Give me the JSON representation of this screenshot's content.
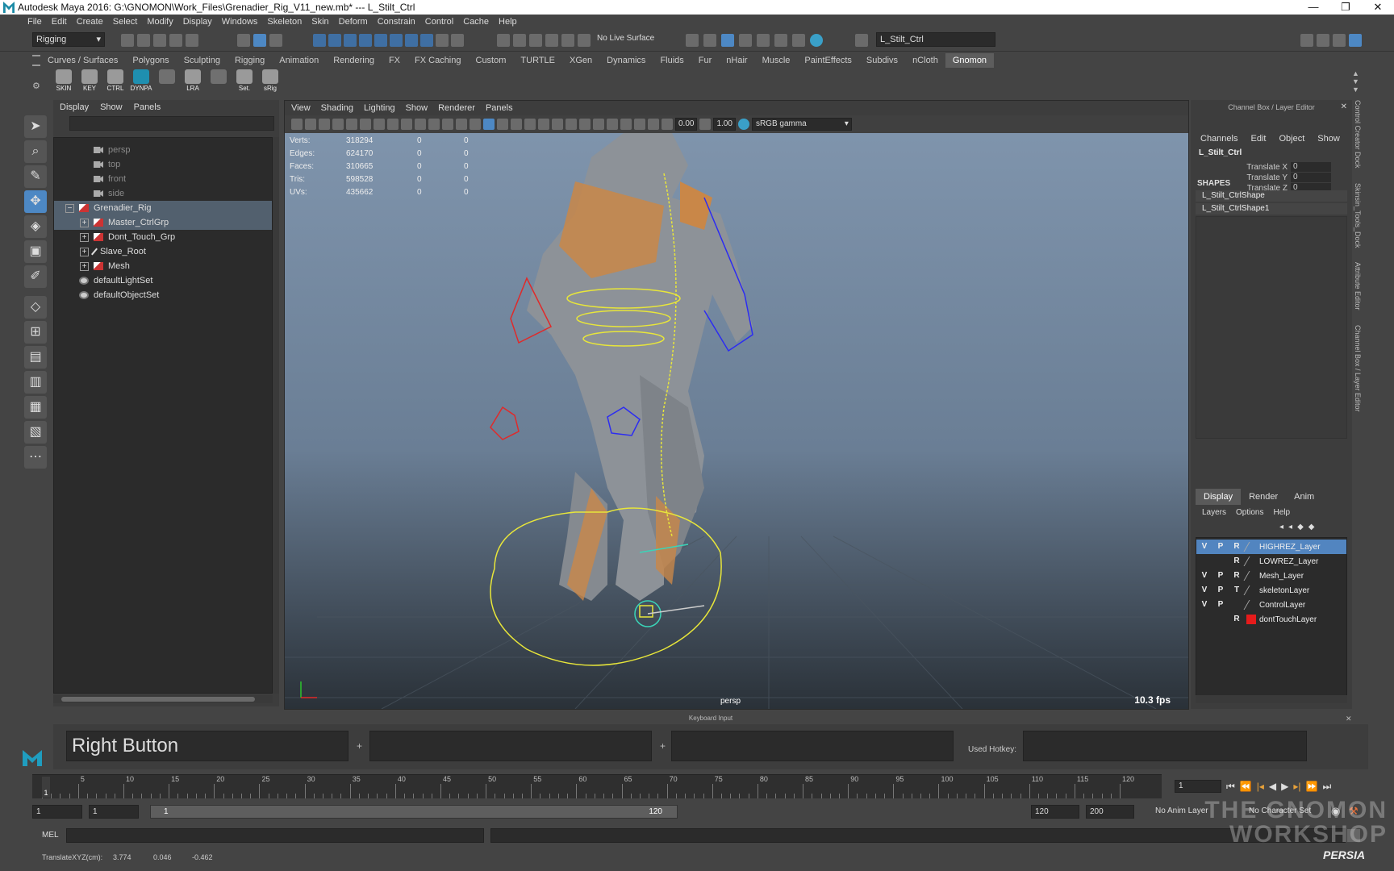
{
  "window": {
    "title": "Autodesk Maya 2016: G:\\GNOMON\\Work_Files\\Grenadier_Rig_V11_new.mb*   ---   L_Stilt_Ctrl",
    "controls": [
      "—",
      "❐",
      "✕"
    ]
  },
  "menubar": [
    "File",
    "Edit",
    "Create",
    "Select",
    "Modify",
    "Display",
    "Windows",
    "Skeleton",
    "Skin",
    "Deform",
    "Constrain",
    "Control",
    "Cache",
    "Help"
  ],
  "toolbar": {
    "menuset": "Rigging",
    "live_surface": "No Live Surface",
    "name_field": "L_Stilt_Ctrl"
  },
  "shelf": {
    "tabs": [
      "Curves / Surfaces",
      "Polygons",
      "Sculpting",
      "Rigging",
      "Animation",
      "Rendering",
      "FX",
      "FX Caching",
      "Custom",
      "TURTLE",
      "XGen",
      "Dynamics",
      "Fluids",
      "Fur",
      "nHair",
      "Muscle",
      "PaintEffects",
      "Subdivs",
      "nCloth",
      "Gnomon"
    ],
    "active_tab": "Gnomon",
    "buttons": [
      {
        "label": "SKIN",
        "color": "#9a9a9a"
      },
      {
        "label": "KEY",
        "color": "#9a9a9a"
      },
      {
        "label": "CTRL",
        "color": "#9a9a9a"
      },
      {
        "label": "DYNPA",
        "color": "#1f8fb0"
      },
      {
        "label": "",
        "color": "#707070"
      },
      {
        "label": "LRA",
        "color": "#9a9a9a"
      },
      {
        "label": "",
        "color": "#707070"
      },
      {
        "label": "Set.",
        "color": "#9a9a9a"
      },
      {
        "label": "sRig",
        "color": "#9a9a9a"
      }
    ]
  },
  "outliner": {
    "menu": [
      "Display",
      "Show",
      "Panels"
    ],
    "items": [
      {
        "label": "persp",
        "indent": 1,
        "icon": "camera-icon",
        "dim": true
      },
      {
        "label": "top",
        "indent": 1,
        "icon": "camera-icon",
        "dim": true
      },
      {
        "label": "front",
        "indent": 1,
        "icon": "camera-icon",
        "dim": true
      },
      {
        "label": "side",
        "indent": 1,
        "icon": "camera-icon",
        "dim": true
      },
      {
        "label": "Grenadier_Rig",
        "indent": 0,
        "icon": "group-icon",
        "expand": "−",
        "selected": true
      },
      {
        "label": "Master_CtrlGrp",
        "indent": 1,
        "icon": "group-icon",
        "expand": "+",
        "selected": true
      },
      {
        "label": "Dont_Touch_Grp",
        "indent": 1,
        "icon": "group-icon",
        "expand": "+"
      },
      {
        "label": "Slave_Root",
        "indent": 1,
        "icon": "joint-icon",
        "expand": "+"
      },
      {
        "label": "Mesh",
        "indent": 1,
        "icon": "group-icon",
        "expand": "+"
      },
      {
        "label": "defaultLightSet",
        "indent": 0,
        "icon": "set-icon"
      },
      {
        "label": "defaultObjectSet",
        "indent": 0,
        "icon": "set-icon"
      }
    ]
  },
  "viewport": {
    "menu": [
      "View",
      "Shading",
      "Lighting",
      "Show",
      "Renderer",
      "Panels"
    ],
    "exposure": "0.00",
    "gamma": "1.00",
    "colorspace": "sRGB gamma",
    "hud": [
      {
        "k": "Verts:",
        "v": "318294",
        "a": "0",
        "b": "0"
      },
      {
        "k": "Edges:",
        "v": "624170",
        "a": "0",
        "b": "0"
      },
      {
        "k": "Faces:",
        "v": "310665",
        "a": "0",
        "b": "0"
      },
      {
        "k": "Tris:",
        "v": "598528",
        "a": "0",
        "b": "0"
      },
      {
        "k": "UVs:",
        "v": "435662",
        "a": "0",
        "b": "0"
      }
    ],
    "camera": "persp",
    "fps": "10.3 fps"
  },
  "channelbox": {
    "title": "Channel Box / Layer Editor",
    "menu": [
      "Channels",
      "Edit",
      "Object",
      "Show"
    ],
    "object": "L_Stilt_Ctrl",
    "attrs": [
      {
        "name": "Translate X",
        "value": "0"
      },
      {
        "name": "Translate Y",
        "value": "0"
      },
      {
        "name": "Translate Z",
        "value": "0"
      }
    ],
    "shapes_header": "SHAPES",
    "shapes": [
      "L_Stilt_CtrlShape",
      "L_Stilt_CtrlShape1"
    ]
  },
  "layers": {
    "tabs": [
      "Display",
      "Render",
      "Anim"
    ],
    "active_tab": "Display",
    "menu": [
      "Layers",
      "Options",
      "Help"
    ],
    "rows": [
      {
        "v": "V",
        "p": "P",
        "r": "R",
        "name": "HIGHREZ_Layer",
        "selected": true,
        "color": ""
      },
      {
        "v": "",
        "p": "",
        "r": "R",
        "name": "LOWREZ_Layer",
        "color": ""
      },
      {
        "v": "V",
        "p": "P",
        "r": "R",
        "name": "Mesh_Layer",
        "color": ""
      },
      {
        "v": "V",
        "p": "P",
        "r": "T",
        "name": "skeletonLayer",
        "color": ""
      },
      {
        "v": "V",
        "p": "P",
        "r": "",
        "name": "ControlLayer",
        "color": ""
      },
      {
        "v": "",
        "p": "",
        "r": "R",
        "name": "dontTouchLayer",
        "color": "#e61b1b"
      }
    ]
  },
  "side_tabs": [
    "Control Creator Dock",
    "Skinsin_Tools_Dock",
    "Attribute Editor",
    "Channel Box / Layer Editor"
  ],
  "keyboard_input": {
    "title": "Keyboard Input",
    "key1": "Right Button",
    "key2": "",
    "key3": "",
    "plus": "+",
    "hotkey_label": "Used Hotkey:",
    "hotkey": ""
  },
  "timeline": {
    "ticks": [
      "1",
      "5",
      "10",
      "15",
      "20",
      "25",
      "30",
      "35",
      "40",
      "45",
      "50",
      "55",
      "60",
      "65",
      "70",
      "75",
      "80",
      "85",
      "90",
      "95",
      "100",
      "105",
      "110",
      "115",
      "120"
    ],
    "current": "1",
    "current_frame_field": "1"
  },
  "range": {
    "start": "1",
    "playback_start": "1",
    "slider_start": "1",
    "slider_end": "120",
    "playback_end": "120",
    "end": "200",
    "anim_layer": "No Anim Layer",
    "char_set": "No Character Set"
  },
  "mel": {
    "label": "MEL"
  },
  "status": {
    "text": "TranslateXYZ(cm):",
    "x": "3.774",
    "y": "0.046",
    "z": "-0.462"
  },
  "watermark": {
    "line1": "THE GNOMON",
    "line2": "WORKSHOP",
    "brand": "PERSIA"
  }
}
